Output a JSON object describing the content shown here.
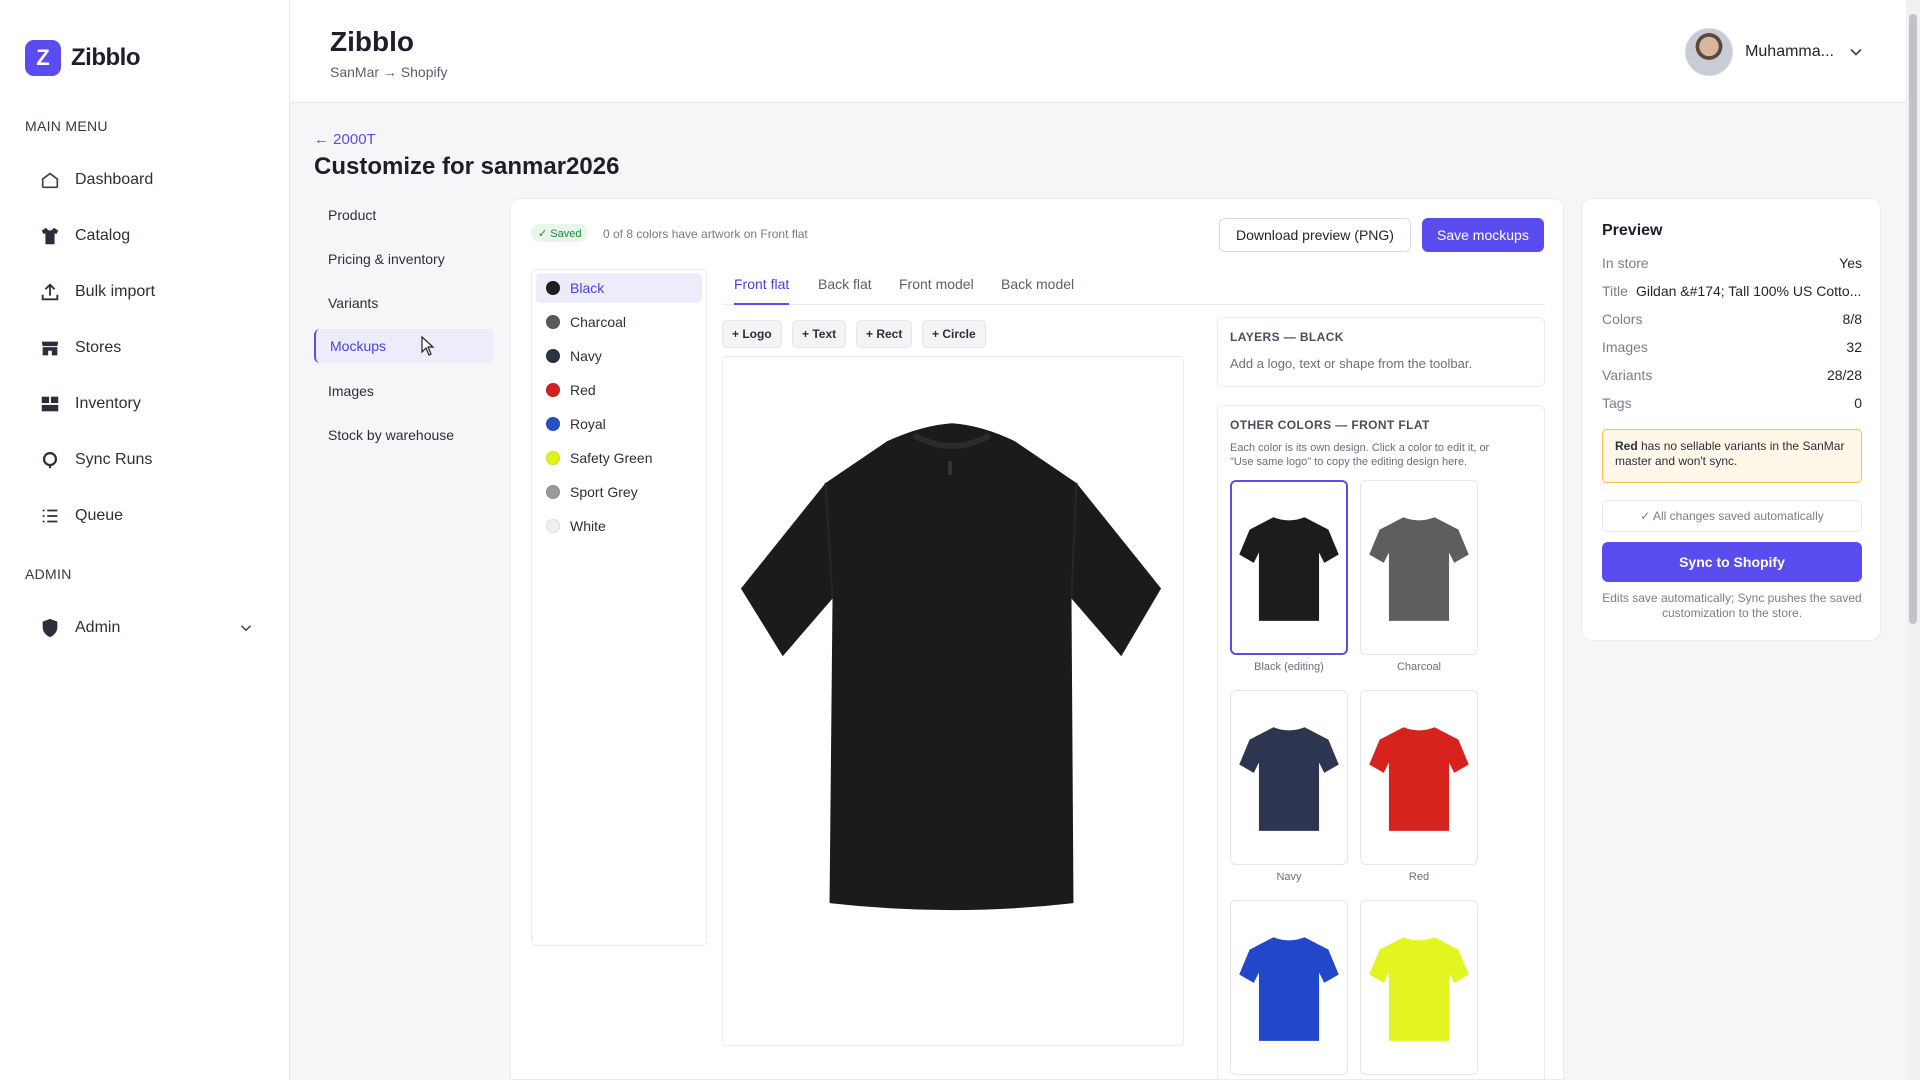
{
  "brand": {
    "name": "Zibblo",
    "logo_letter": "Z",
    "accent": "#5b4cf0"
  },
  "sidebar": {
    "main_heading": "MAIN MENU",
    "items": [
      {
        "label": "Dashboard",
        "icon": "home-icon"
      },
      {
        "label": "Catalog",
        "icon": "shirt-icon"
      },
      {
        "label": "Bulk import",
        "icon": "upload-icon"
      },
      {
        "label": "Stores",
        "icon": "store-icon"
      },
      {
        "label": "Inventory",
        "icon": "grid-icon"
      },
      {
        "label": "Sync Runs",
        "icon": "circle-icon"
      },
      {
        "label": "Queue",
        "icon": "list-icon"
      }
    ],
    "admin_heading": "ADMIN",
    "admin_item": {
      "label": "Admin",
      "icon": "shield-icon"
    }
  },
  "header": {
    "title": "Zibblo",
    "subtitle": "SanMar → Shopify",
    "user_name": "Muhamma..."
  },
  "page": {
    "back_link": "← 2000T",
    "title": "Customize for sanmar2026"
  },
  "subnav": {
    "items": [
      "Product",
      "Pricing & inventory",
      "Variants",
      "Mockups",
      "Images",
      "Stock by warehouse"
    ],
    "active": "Mockups"
  },
  "editor": {
    "saved_badge": "✓ Saved",
    "artwork_status": "0 of 8 colors have artwork on Front flat",
    "download_label": "Download preview (PNG)",
    "save_label": "Save mockups",
    "colors": [
      {
        "name": "Black",
        "hex": "#1f1f1f"
      },
      {
        "name": "Charcoal",
        "hex": "#5a5a5a"
      },
      {
        "name": "Navy",
        "hex": "#2b3245"
      },
      {
        "name": "Red",
        "hex": "#d42020"
      },
      {
        "name": "Royal",
        "hex": "#2a4fc2"
      },
      {
        "name": "Safety Green",
        "hex": "#dff21f"
      },
      {
        "name": "Sport Grey",
        "hex": "#9a9a9a"
      },
      {
        "name": "White",
        "hex": "#f0f0f0"
      }
    ],
    "active_color": "Black",
    "tabs": [
      "Front flat",
      "Back flat",
      "Front model",
      "Back model"
    ],
    "active_tab": "Front flat",
    "tools": [
      "+ Logo",
      "+ Text",
      "+ Rect",
      "+ Circle"
    ],
    "layers": {
      "title": "LAYERS — BLACK",
      "hint": "Add a logo, text or shape from the toolbar."
    },
    "other_colors": {
      "title": "OTHER COLORS — FRONT FLAT",
      "hint_line1": "Each color is its own design. Click a color to edit it, or",
      "hint_line2": "\"Use same logo\" to copy the editing design here.",
      "thumbs": [
        {
          "label": "Black (editing)",
          "hex": "#1c1c1c"
        },
        {
          "label": "Charcoal",
          "hex": "#5e5e5e"
        },
        {
          "label": "Navy",
          "hex": "#2e3550"
        },
        {
          "label": "Red",
          "hex": "#d6231e"
        },
        {
          "label": "",
          "hex": "#2247c9"
        },
        {
          "label": "",
          "hex": "#e2f521"
        }
      ]
    }
  },
  "preview": {
    "title": "Preview",
    "rows": [
      {
        "label": "In store",
        "value": "Yes"
      },
      {
        "label": "Title",
        "value": "Gildan &#174; Tall 100% US Cotto..."
      },
      {
        "label": "Colors",
        "value": "8/8"
      },
      {
        "label": "Images",
        "value": "32"
      },
      {
        "label": "Variants",
        "value": "28/28"
      },
      {
        "label": "Tags",
        "value": "0"
      }
    ],
    "warning_bold": "Red",
    "warning_rest": " has no sellable variants in the SanMar master and won't sync.",
    "auto_saved": "✓ All changes saved automatically",
    "sync_label": "Sync to Shopify",
    "footnote": "Edits save automatically; Sync pushes the saved customization to the store."
  }
}
